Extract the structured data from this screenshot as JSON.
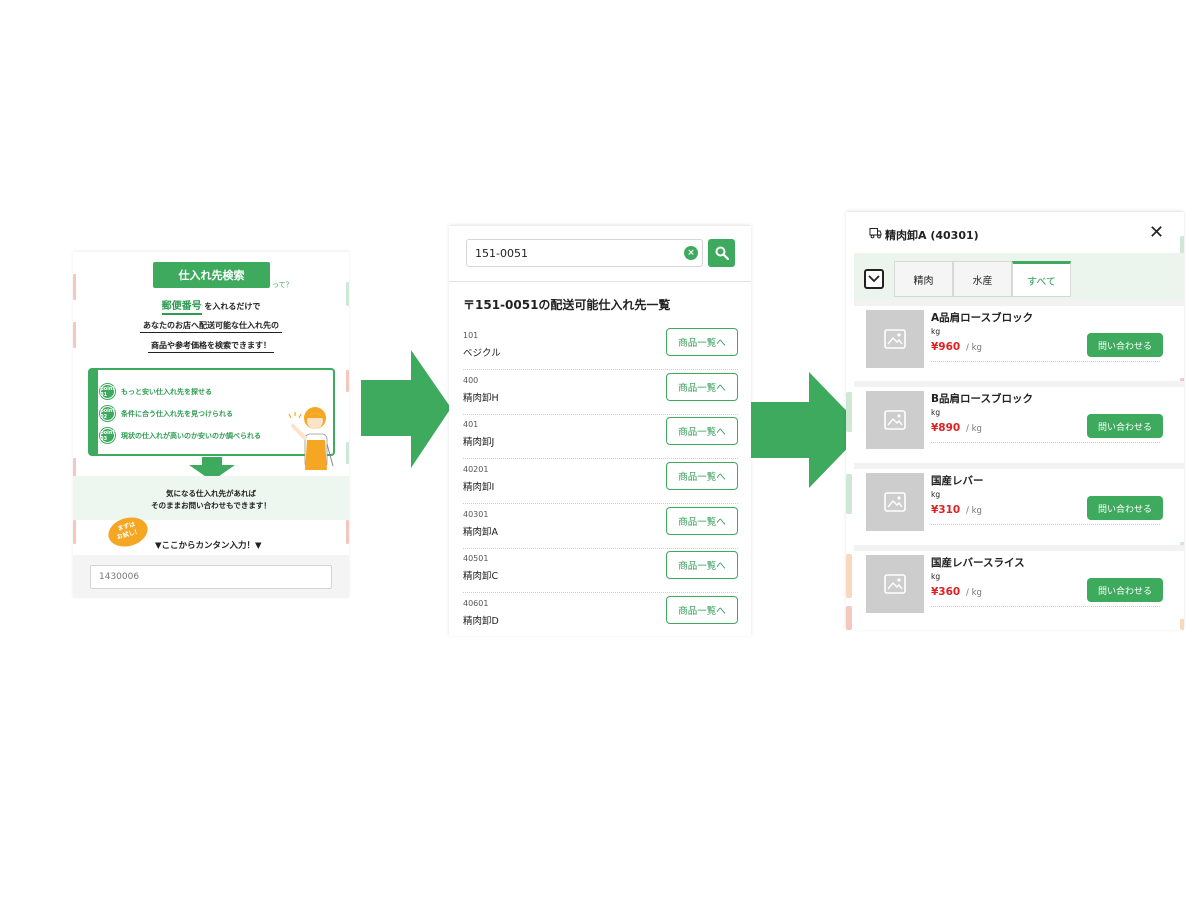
{
  "landing": {
    "title_button": "仕入れ先検索",
    "title_suffix": "って？",
    "line1_zip": "郵便番号",
    "line1_rest": "を入れるだけで",
    "line2": "あなたのお店へ配送可能な仕入れ先の",
    "line3": "商品や参考価格を検索できます！",
    "points": [
      {
        "num": "point 01",
        "text": "もっと安い仕入れ先を探せる"
      },
      {
        "num": "point 02",
        "text": "条件に合う仕入れ先を見つけられる"
      },
      {
        "num": "point 03",
        "text": "現状の仕入れが高いのか安いのか調べられる"
      }
    ],
    "band_line1": "気になる仕入れ先があれば",
    "band_line2": "そのままお問い合わせもできます！",
    "badge_line1": "まずは",
    "badge_line2": "お試し！",
    "entry_prompt": "▼ここからカンタン入力！▼",
    "zip_input_value": "1430006"
  },
  "results": {
    "search_value": "151-0051",
    "title": "〒151-0051の配送可能仕入れ先一覧",
    "list_button": "商品一覧へ",
    "suppliers": [
      {
        "code": "101",
        "name": "ベジクル"
      },
      {
        "code": "400",
        "name": "精肉卸H"
      },
      {
        "code": "401",
        "name": "精肉卸J"
      },
      {
        "code": "40201",
        "name": "精肉卸I"
      },
      {
        "code": "40301",
        "name": "精肉卸A"
      },
      {
        "code": "40501",
        "name": "精肉卸C"
      },
      {
        "code": "40601",
        "name": "精肉卸D"
      }
    ]
  },
  "detail": {
    "title": "精肉卸A (40301)",
    "tabs": [
      {
        "label": "精肉",
        "active": false
      },
      {
        "label": "水産",
        "active": false
      },
      {
        "label": "すべて",
        "active": true
      }
    ],
    "contact_button": "問い合わせる",
    "products": [
      {
        "name": "A品肩ロースブロック",
        "unit": "kg",
        "price": "¥960",
        "per": "/ kg"
      },
      {
        "name": "B品肩ロースブロック",
        "unit": "kg",
        "price": "¥890",
        "per": "/ kg"
      },
      {
        "name": "国産レバー",
        "unit": "kg",
        "price": "¥310",
        "per": "/ kg"
      },
      {
        "name": "国産レバースライス",
        "unit": "kg",
        "price": "¥360",
        "per": "/ kg"
      }
    ]
  },
  "colors": {
    "brand_green": "#3daa5e",
    "price_red": "#e02020",
    "badge_orange": "#f5a623",
    "band_bg": "#edf6ef"
  },
  "icons": [
    "search-icon",
    "clear-icon",
    "truck-icon",
    "close-icon",
    "chevron-down-icon",
    "image-placeholder-icon",
    "arrow-right-icon",
    "arrow-down-icon"
  ]
}
